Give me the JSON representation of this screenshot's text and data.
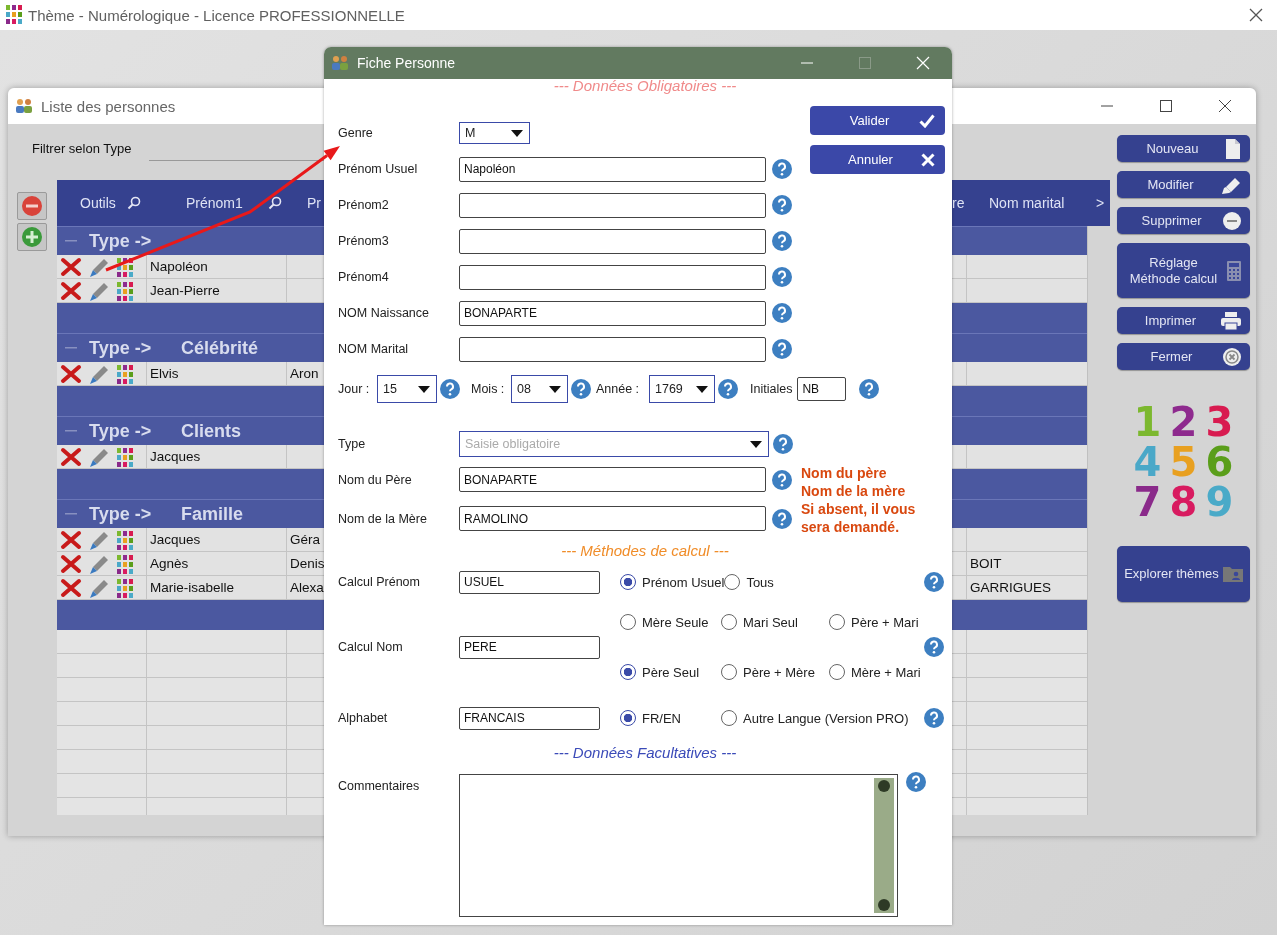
{
  "app_window": {
    "title": "Thème - Numérologique - Licence PROFESSIONNELLE"
  },
  "list_window": {
    "title": "Liste des personnes",
    "filter": {
      "label": "Filtrer selon Type"
    },
    "grid": {
      "columns": [
        {
          "label": "Outils",
          "search": true
        },
        {
          "label": "Prénom1",
          "search": true
        },
        {
          "label": "Pr",
          "search": false
        },
        {
          "label": "re",
          "search": false
        },
        {
          "label": "Nom marital",
          "search": false
        }
      ],
      "more": ">",
      "groups": [
        {
          "prefix": "Type ->",
          "rows": [
            {
              "prenom1": "Napoléon"
            },
            {
              "prenom1": "Jean-Pierre"
            }
          ]
        },
        {
          "prefix": "Type ->",
          "name": "Célébrité",
          "rows": [
            {
              "prenom1": "Elvis",
              "column_3": "Aron"
            }
          ]
        },
        {
          "prefix": "Type ->",
          "name": "Clients",
          "rows": [
            {
              "prenom1": "Jacques"
            }
          ]
        },
        {
          "prefix": "Type ->",
          "name": "Famille",
          "rows": [
            {
              "prenom1": "Jacques",
              "column_3": "Géra"
            },
            {
              "prenom1": "Agnès",
              "column_3": "Denis",
              "nom_marital": "BOIT"
            },
            {
              "prenom1": "Marie-isabelle",
              "column_3": "Alexa",
              "nom_marital": "GARRIGUES"
            }
          ]
        }
      ]
    },
    "side_buttons": [
      {
        "label": "Nouveau",
        "kind": "document"
      },
      {
        "label": "Modifier",
        "kind": "pencil"
      },
      {
        "label": "Supprimer",
        "kind": "minus"
      },
      {
        "label": "Réglage\nMéthode calcul",
        "kind": "calculator"
      },
      {
        "label": "Imprimer",
        "kind": "printer"
      },
      {
        "label": "Fermer",
        "kind": "close"
      }
    ],
    "logo": [
      {
        "digit": "1",
        "color": "#7cb82f"
      },
      {
        "digit": "2",
        "color": "#8e2a8e"
      },
      {
        "digit": "3",
        "color": "#d81b50"
      },
      {
        "digit": "4",
        "color": "#4aa8c8"
      },
      {
        "digit": "5",
        "color": "#e8a020"
      },
      {
        "digit": "6",
        "color": "#5a9e1a"
      },
      {
        "digit": "7",
        "color": "#8a2a8a"
      },
      {
        "digit": "8",
        "color": "#d81b60"
      },
      {
        "digit": "9",
        "color": "#4aaac8"
      }
    ],
    "explore_button": {
      "label": "Explorer thèmes"
    }
  },
  "dialog": {
    "title": "Fiche Personne",
    "required_heading": "--- Données Obligatoires ---",
    "genre": {
      "label": "Genre",
      "value": "M"
    },
    "name_fields": [
      {
        "label": "Prénom Usuel",
        "value": "Napoléon"
      },
      {
        "label": "Prénom2"
      },
      {
        "label": "Prénom3"
      },
      {
        "label": "Prénom4"
      },
      {
        "label": "NOM Naissance",
        "value": "BONAPARTE"
      },
      {
        "label": "NOM Marital"
      }
    ],
    "actions": [
      {
        "label": "Valider",
        "kind": "check"
      },
      {
        "label": "Annuler",
        "kind": "cross"
      }
    ],
    "date": [
      {
        "label": "Jour :",
        "value": "15"
      },
      {
        "label": "Mois :",
        "value": "08"
      },
      {
        "label": "Année :",
        "value": "1769"
      }
    ],
    "initials": {
      "label": "Initiales",
      "value": "NB"
    },
    "type": {
      "label": "Type",
      "placeholder": "Saisie obligatoire"
    },
    "parent_fields": [
      {
        "label": "Nom du Père",
        "value": "BONAPARTE"
      },
      {
        "label": "Nom de la Mère",
        "value": "RAMOLINO"
      }
    ],
    "parent_note": [
      "Nom du père",
      "Nom de la mère",
      "Si absent, il vous",
      "sera demandé."
    ],
    "methods_heading": "--- Méthodes de calcul ---",
    "methods": [
      {
        "label": "Calcul Prénom",
        "value": "USUEL",
        "option_rows": [
          [
            {
              "label": "Prénom Usuel",
              "selected": true
            },
            {
              "label": "Tous",
              "selected": false
            }
          ]
        ]
      },
      {
        "label": "Calcul Nom",
        "value": "PERE",
        "option_rows": [
          [
            {
              "label": "Mère Seule",
              "selected": false
            },
            {
              "label": "Mari Seul",
              "selected": false
            },
            {
              "label": "Père + Mari",
              "selected": false
            }
          ],
          [
            {
              "label": "Père Seul",
              "selected": true
            },
            {
              "label": "Père + Mère",
              "selected": false
            },
            {
              "label": "Mère + Mari",
              "selected": false
            }
          ]
        ]
      },
      {
        "label": "Alphabet",
        "value": "FRANCAIS",
        "option_rows": [
          [
            {
              "label": "FR/EN",
              "selected": true
            },
            {
              "label": "Autre Langue (Version PRO)",
              "selected": false
            }
          ]
        ]
      }
    ],
    "optional_heading": "--- Données Facultatives ---",
    "comments": {
      "label": "Commentaires"
    }
  }
}
